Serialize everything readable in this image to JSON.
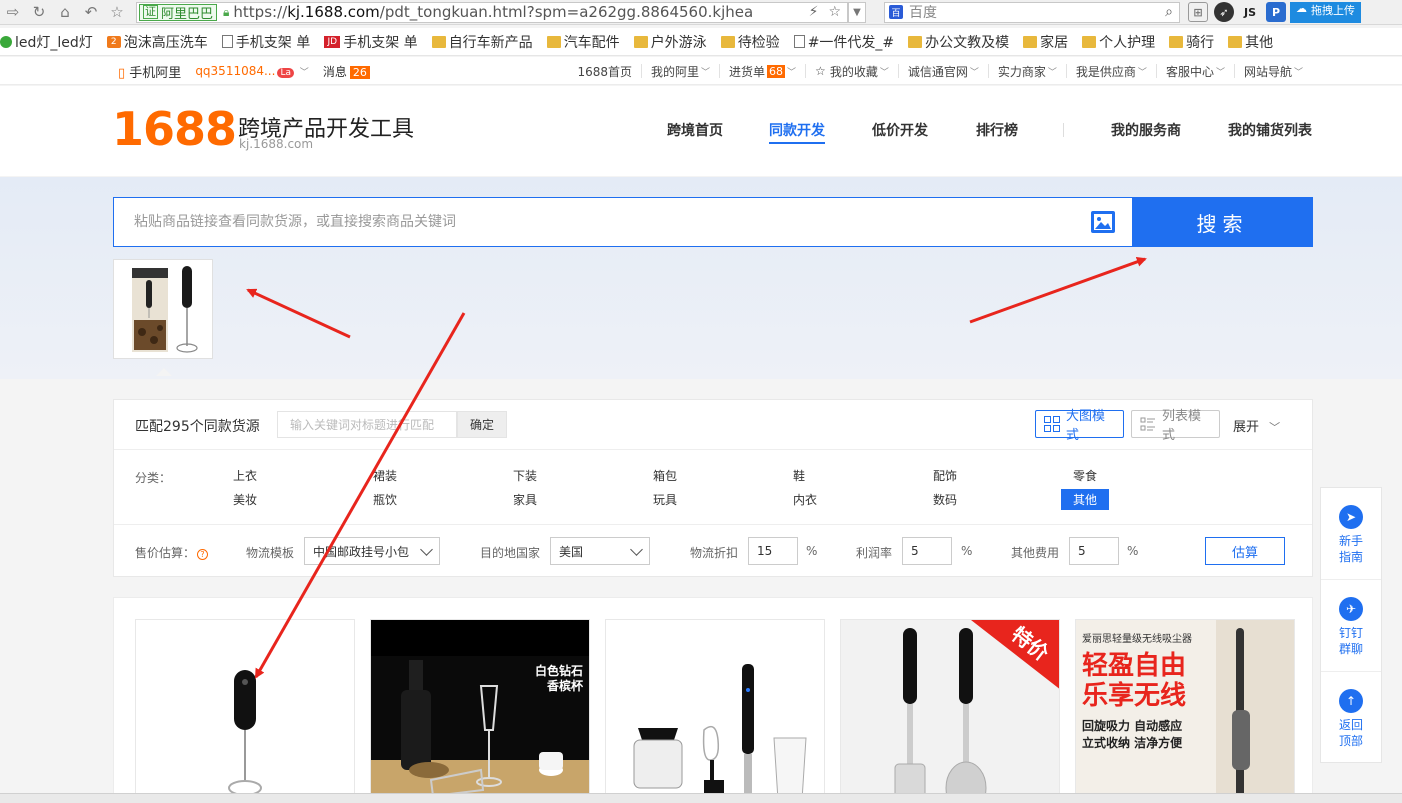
{
  "browser": {
    "cert_label": "阿里巴巴",
    "url_prefix": "https://",
    "url_host": "kj.1688.com",
    "url_path": "/pdt_tongkuan.html?spm=a262gg.8864560.kjheade",
    "search_engine": "百度",
    "drag_upload": "拖拽上传",
    "bookmarks": [
      "led灯_led灯",
      "泡沫高压洗车",
      "手机支架 单",
      "手机支架 单",
      "自行车新产品",
      "汽车配件",
      "户外游泳",
      "待检验",
      "#一件代发_#",
      "办公文教及模",
      "家居",
      "个人护理",
      "骑行",
      "其他"
    ]
  },
  "site_top": {
    "mobile": "手机阿里",
    "user": "qq3511084...",
    "user_badge": "La",
    "message": "消息",
    "message_count": "26",
    "links": [
      {
        "label": "1688首页"
      },
      {
        "label": "我的阿里",
        "caret": true
      },
      {
        "label": "进货单",
        "badge": "68",
        "caret": true
      },
      {
        "label": "我的收藏",
        "caret": true,
        "star": true
      },
      {
        "label": "诚信通官网",
        "caret": true
      },
      {
        "label": "实力商家",
        "caret": true
      },
      {
        "label": "我是供应商",
        "caret": true
      },
      {
        "label": "客服中心",
        "caret": true
      },
      {
        "label": "网站导航",
        "caret": true
      }
    ]
  },
  "header": {
    "logo": "1688",
    "title": "跨境产品开发工具",
    "subtitle": "kj.1688.com",
    "nav": [
      "跨境首页",
      "同款开发",
      "低价开发",
      "排行榜",
      "我的服务商",
      "我的铺货列表"
    ],
    "active_nav": "同款开发"
  },
  "search": {
    "placeholder": "粘贴商品链接查看同款货源，或直接搜索商品关键词",
    "button": "搜索"
  },
  "filter": {
    "match_count": "匹配295个同款货源",
    "keyword_placeholder": "输入关键词对标题进行匹配",
    "confirm": "确定",
    "mode_grid": "大图模式",
    "mode_list": "列表模式",
    "expand": "展开",
    "category_label": "分类：",
    "categories_row1": [
      "上衣",
      "裙装",
      "下装",
      "箱包",
      "鞋",
      "配饰",
      "零食"
    ],
    "categories_row2": [
      "美妆",
      "瓶饮",
      "家具",
      "玩具",
      "内衣",
      "数码",
      "其他"
    ],
    "selected_category": "其他",
    "price_label": "售价估算：",
    "logistics_label": "物流模板",
    "logistics_value": "中国邮政挂号小包",
    "country_label": "目的地国家",
    "country_value": "美国",
    "discount_label": "物流折扣",
    "discount_value": "15",
    "profit_label": "利润率",
    "profit_value": "5",
    "other_label": "其他费用",
    "other_value": "5",
    "percent": "%",
    "calc": "估算"
  },
  "results": {
    "card2_text1": "白色钻石",
    "card2_text2": "香槟杯",
    "card4_badge": "特价",
    "card5_head": "爱丽思轻量级无线吸尘器",
    "card5_big1": "轻盈自由",
    "card5_big2": "乐享无线",
    "card5_line1": "回旋吸力 自动感应",
    "card5_line2": "立式收纳 洁净方便"
  },
  "float_tools": [
    {
      "label1": "新手",
      "label2": "指南"
    },
    {
      "label1": "钉钉",
      "label2": "群聊"
    },
    {
      "label1": "返回",
      "label2": "顶部"
    }
  ],
  "colors": {
    "brand_orange": "#ff6a00",
    "primary_blue": "#1f6ff0",
    "arrow_red": "#e8251d"
  }
}
